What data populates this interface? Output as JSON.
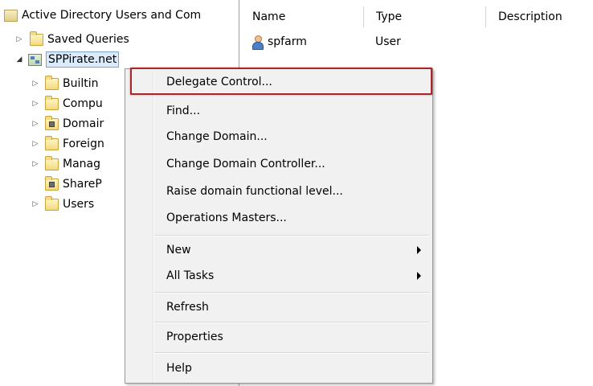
{
  "tree": {
    "root_label": "Active Directory Users and Com",
    "saved_queries": "Saved Queries",
    "domain": "SPPirate.net",
    "children": [
      {
        "label": "Builtin"
      },
      {
        "label": "Compu"
      },
      {
        "label": "Domair"
      },
      {
        "label": "Foreign"
      },
      {
        "label": "Manag"
      },
      {
        "label": "ShareP"
      },
      {
        "label": "Users"
      }
    ]
  },
  "list": {
    "columns": [
      "Name",
      "Type",
      "Description"
    ],
    "rows": [
      {
        "name": "spfarm",
        "type": "User",
        "description": ""
      }
    ]
  },
  "menu": {
    "items": [
      {
        "label": "Delegate Control..."
      },
      {
        "label": "Find..."
      },
      {
        "label": "Change Domain..."
      },
      {
        "label": "Change Domain Controller..."
      },
      {
        "label": "Raise domain functional level..."
      },
      {
        "label": "Operations Masters..."
      },
      {
        "label": "New"
      },
      {
        "label": "All Tasks"
      },
      {
        "label": "Refresh"
      },
      {
        "label": "Properties"
      },
      {
        "label": "Help"
      }
    ]
  }
}
